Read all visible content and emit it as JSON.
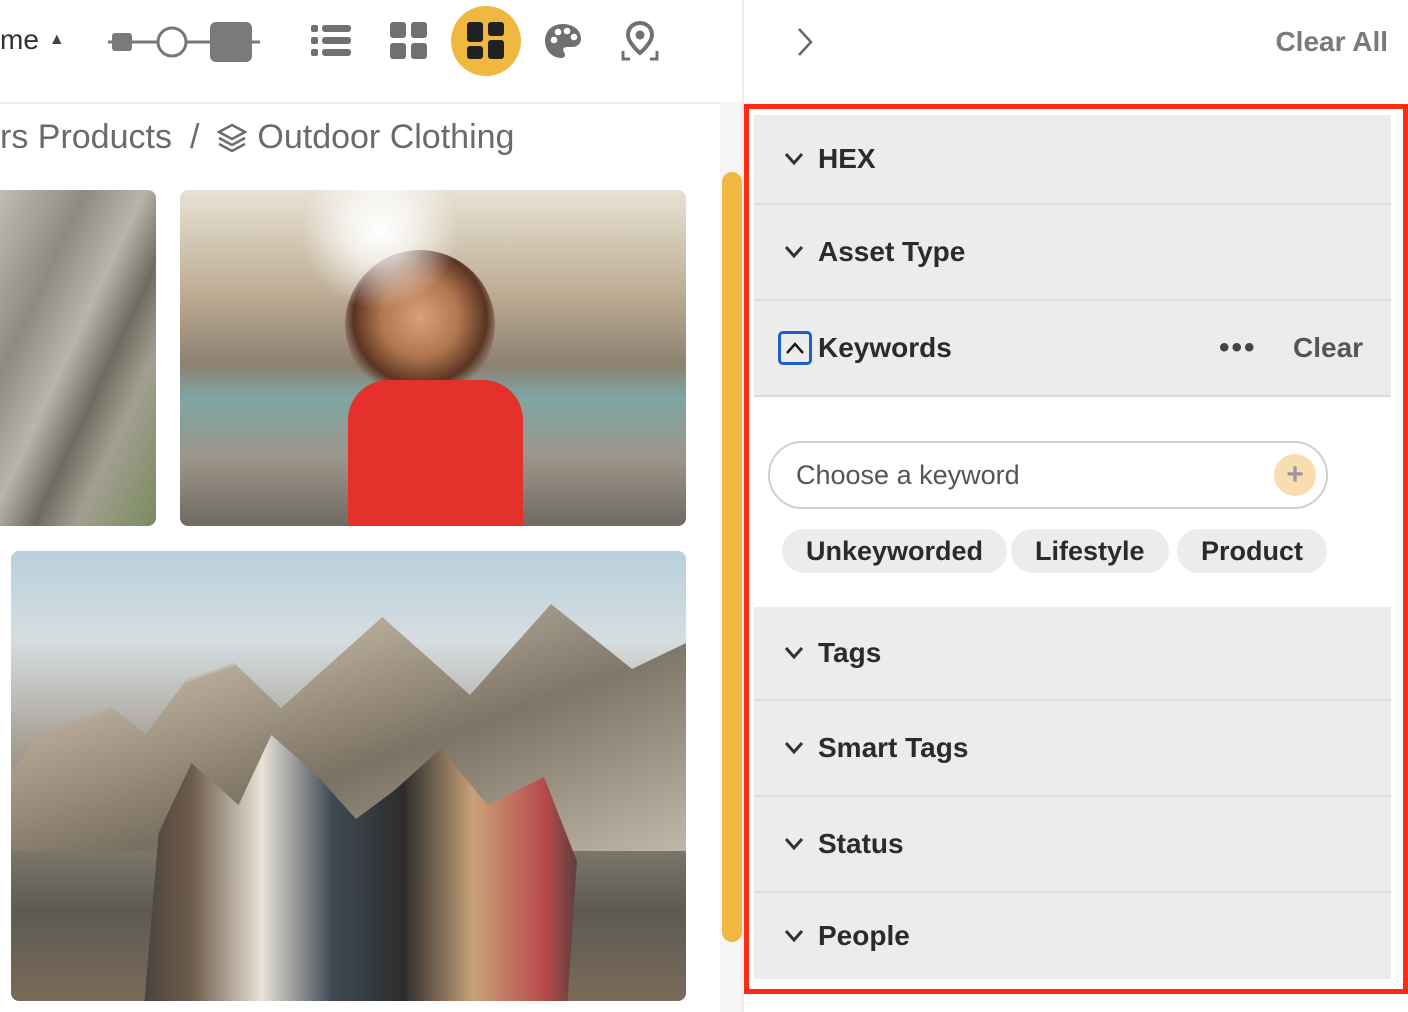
{
  "toolbar": {
    "sort_label": "me",
    "views": [
      {
        "name": "list-view",
        "icon": "list-icon"
      },
      {
        "name": "grid-view",
        "icon": "grid-icon"
      },
      {
        "name": "mosaic-view",
        "icon": "mosaic-icon",
        "active": true
      },
      {
        "name": "palette-view",
        "icon": "palette-icon"
      },
      {
        "name": "map-view",
        "icon": "map-pin-icon"
      }
    ],
    "accent": "#f0b840"
  },
  "breadcrumb": {
    "parent": "rs Products",
    "separator": "/",
    "current": "Outdoor Clothing"
  },
  "panel": {
    "clear_all": "Clear All",
    "sections": [
      {
        "label": "HEX"
      },
      {
        "label": "Asset Type"
      },
      {
        "label": "Keywords",
        "expanded": true
      },
      {
        "label": "Tags"
      },
      {
        "label": "Smart Tags"
      },
      {
        "label": "Status"
      },
      {
        "label": "People"
      }
    ],
    "keywords": {
      "more": "•••",
      "clear": "Clear",
      "placeholder": "Choose a keyword",
      "add": "+",
      "chips": [
        "Unkeyworded",
        "Lifestyle",
        "Product"
      ]
    },
    "highlight_color": "#ff2a10"
  }
}
